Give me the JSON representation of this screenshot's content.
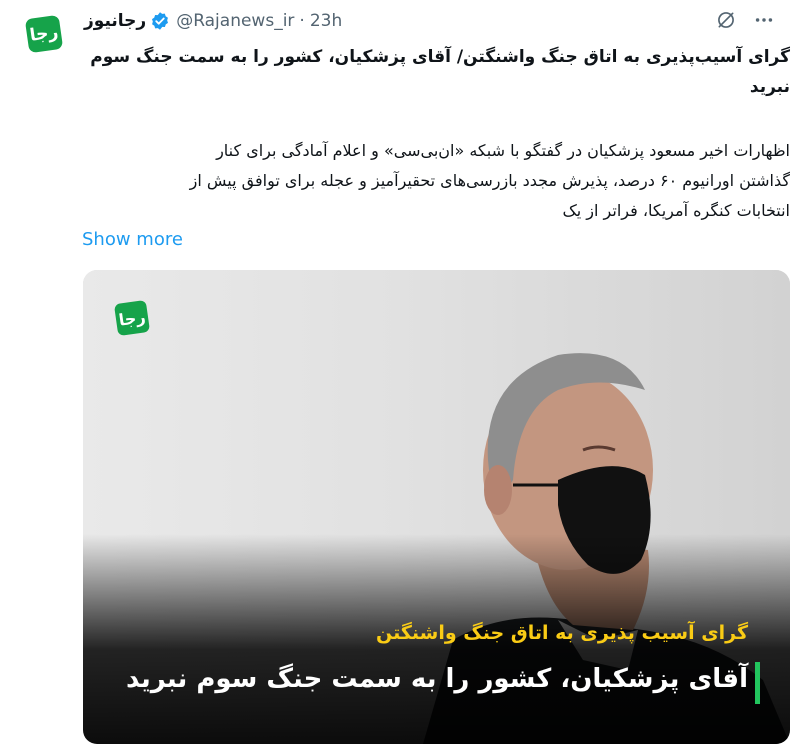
{
  "account": {
    "name": "رجانیوز",
    "handle": "@Rajanews_ir",
    "separator": "·",
    "time": "23h",
    "avatar_text": "رجا"
  },
  "tweet": {
    "title_line1": "گرای آسیب‌پذیری به اتاق جنگ واشنگتن/ آقای پزشکیان، کشور را به سمت جنگ سوم",
    "title_line2": "نبرید",
    "body_line1": "اظهارات اخیر مسعود پزشکیان در گفتگو با شبکه «ان‌بی‌سی» و اعلام آمادگی برای کنار",
    "body_line2": "گذاشتن اورانیوم ۶۰ درصد، پذیرش مجدد بازرسی‌های تحقیرآمیز و عجله برای توافق پیش از",
    "body_line3": "انتخابات کنگره آمریکا، فراتر از یک",
    "show_more": "Show more"
  },
  "media": {
    "logo_text": "رجا",
    "caption_sub": "گرای آسیب پذیری به اتاق جنگ واشنگتن",
    "caption_main": "آقای پزشکیان، کشور را به سمت جنگ سوم نبرید"
  },
  "icons": {
    "verified": "verified-badge-icon",
    "grok": "grok-icon",
    "more": "more-options-icon"
  },
  "colors": {
    "link": "#1d9bf0",
    "verified": "#1d9bf0",
    "brand_green": "#16a34a",
    "caption_yellow": "#facc15"
  }
}
